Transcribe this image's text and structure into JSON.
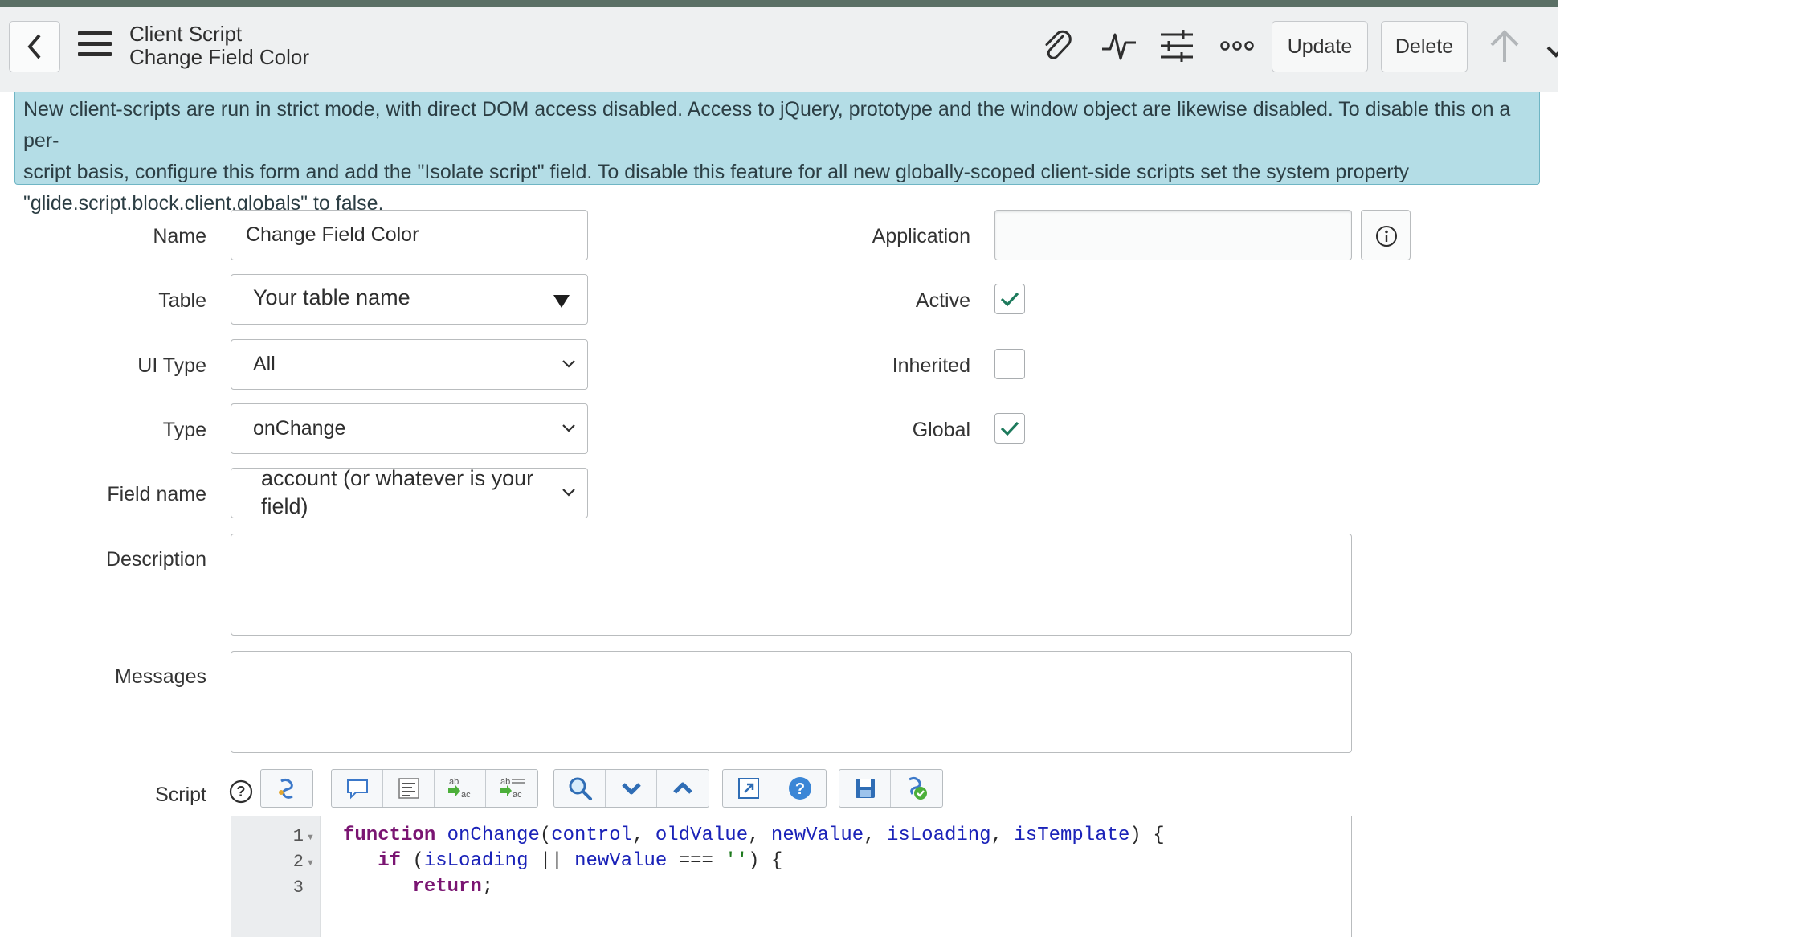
{
  "header": {
    "title": "Client Script",
    "subtitle": "Change Field Color",
    "update_label": "Update",
    "delete_label": "Delete"
  },
  "banner": {
    "line1": "New client-scripts are run in strict mode, with direct DOM access disabled. Access to jQuery, prototype and the window object are likewise disabled. To disable this on a per-",
    "line2": "script basis, configure this form and add the \"Isolate script\" field. To disable this feature for all new globally-scoped client-side scripts set the system property",
    "line3": "\"glide.script.block.client.globals\" to false."
  },
  "form": {
    "name": {
      "label": "Name",
      "value": "Change Field Color"
    },
    "table": {
      "label": "Table",
      "value": "Your table name"
    },
    "ui_type": {
      "label": "UI Type",
      "value": "All"
    },
    "type": {
      "label": "Type",
      "value": "onChange"
    },
    "field_name": {
      "label": "Field name",
      "value_line1": "account (or whatever is your",
      "value_line2": "field)"
    },
    "description": {
      "label": "Description",
      "value": ""
    },
    "messages": {
      "label": "Messages",
      "value": ""
    },
    "script": {
      "label": "Script"
    },
    "application": {
      "label": "Application",
      "value": ""
    },
    "active": {
      "label": "Active",
      "checked": true
    },
    "inherited": {
      "label": "Inherited",
      "checked": false
    },
    "global": {
      "label": "Global",
      "checked": true
    }
  },
  "editor": {
    "line_numbers": [
      "1",
      "2",
      "3"
    ],
    "lines": [
      [
        {
          "t": "function",
          "c": "kw"
        },
        {
          "t": " "
        },
        {
          "t": "onChange",
          "c": "fn"
        },
        {
          "t": "("
        },
        {
          "t": "control",
          "c": "fn"
        },
        {
          "t": ", "
        },
        {
          "t": "oldValue",
          "c": "fn"
        },
        {
          "t": ", "
        },
        {
          "t": "newValue",
          "c": "fn"
        },
        {
          "t": ", "
        },
        {
          "t": "isLoading",
          "c": "fn"
        },
        {
          "t": ", "
        },
        {
          "t": "isTemplate",
          "c": "fn"
        },
        {
          "t": ") {"
        }
      ],
      [
        {
          "t": "   "
        },
        {
          "t": "if",
          "c": "kw"
        },
        {
          "t": " ("
        },
        {
          "t": "isLoading",
          "c": "fn"
        },
        {
          "t": " || "
        },
        {
          "t": "newValue",
          "c": "fn"
        },
        {
          "t": " === "
        },
        {
          "t": "''",
          "c": "str"
        },
        {
          "t": ") {"
        }
      ],
      [
        {
          "t": "      "
        },
        {
          "t": "return",
          "c": "kw"
        },
        {
          "t": ";"
        }
      ]
    ]
  },
  "icons": {
    "header": [
      "chevron-left-icon",
      "menu-icon",
      "paperclip-icon",
      "activity-icon",
      "sliders-icon",
      "more-icon",
      "arrow-up-icon",
      "chevron-down-icon"
    ],
    "toolbar": [
      "script-include-icon",
      "comment-icon",
      "format-icon",
      "replace-icon",
      "replace-all-icon",
      "search-icon",
      "next-icon",
      "previous-icon",
      "fullscreen-icon",
      "help-icon",
      "save-icon",
      "script-debugger-icon"
    ]
  },
  "colors": {
    "banner_bg": "#b4dde6",
    "check": "#1d7a5c",
    "top_strip": "#5b7066"
  }
}
